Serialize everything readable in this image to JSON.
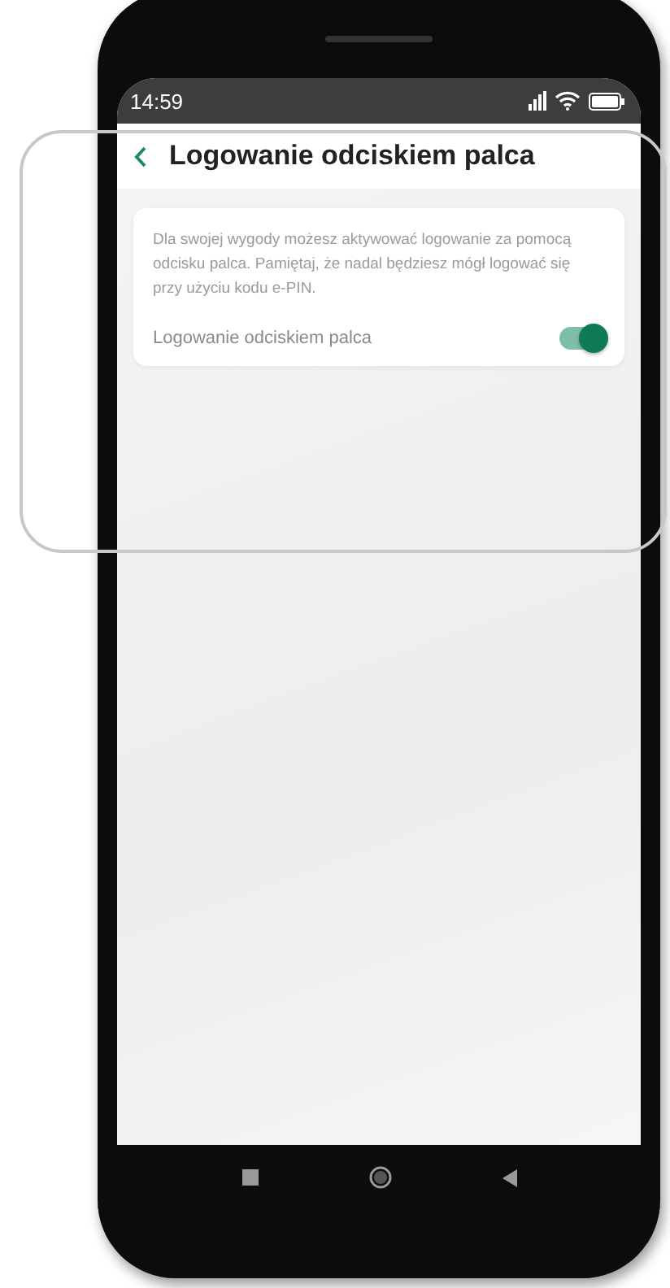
{
  "status_bar": {
    "time": "14:59"
  },
  "header": {
    "title": "Logowanie odciskiem palca"
  },
  "card": {
    "description": "Dla swojej wygody możesz aktywować logowanie za pomocą odcisku palca. Pamiętaj, że nadal będziesz mógł logować się przy użyciu kodu e-PIN.",
    "setting": {
      "label": "Logowanie odciskiem palca",
      "on": true
    }
  }
}
